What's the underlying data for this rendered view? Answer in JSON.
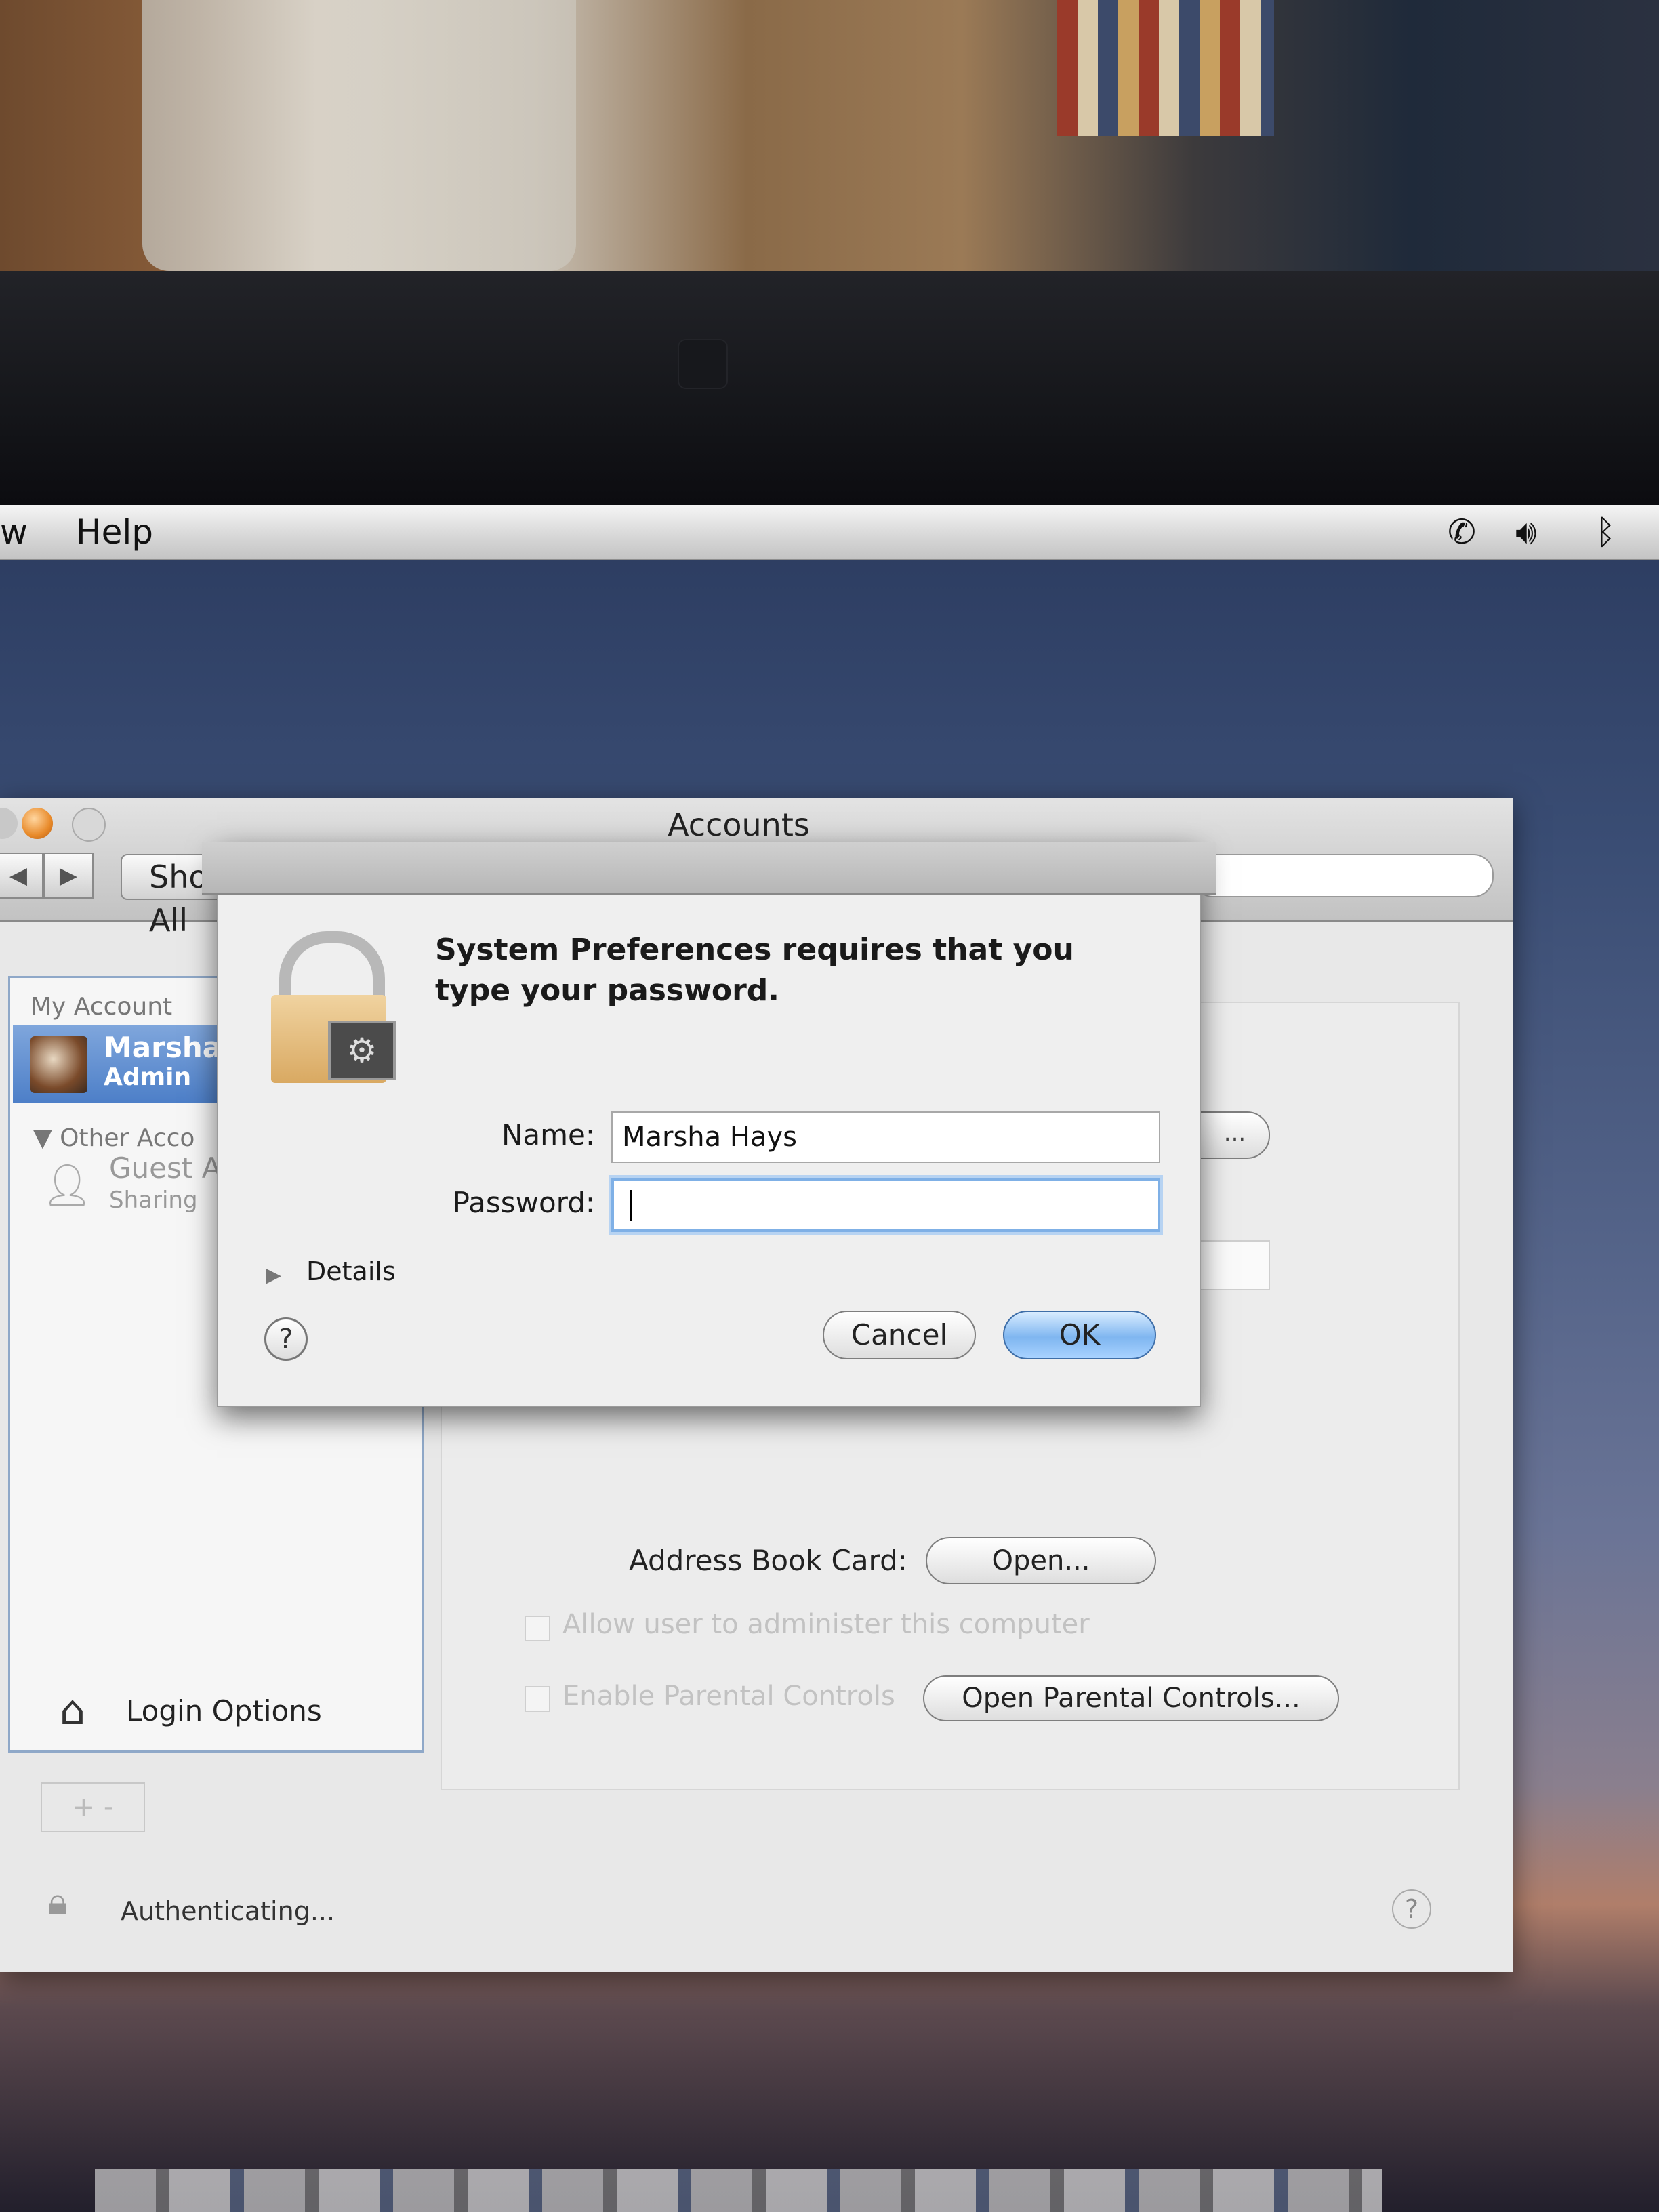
{
  "menubar": {
    "items": [
      "w",
      "Help"
    ],
    "status_icons": [
      "phone-icon",
      "volume-icon",
      "bluetooth-icon"
    ]
  },
  "window": {
    "title": "Accounts",
    "toolbar": {
      "show_all": "Show All"
    },
    "sidebar": {
      "my_account_header": "My Account",
      "user_name": "Marsha",
      "user_role": "Admin",
      "other_accounts_header": "Other Acco",
      "guest_name": "Guest A",
      "guest_sub": "Sharing",
      "login_options": "Login Options",
      "add_remove": "+ -"
    },
    "panel": {
      "address_book_label": "Address Book Card:",
      "open_button": "Open...",
      "allow_admin": "Allow user to administer this computer",
      "enable_parental": "Enable Parental Controls",
      "open_parental_button": "Open Parental Controls...",
      "edit_button": "..."
    },
    "status": {
      "authenticating": "Authenticating..."
    }
  },
  "sheet": {
    "prompt": "System Preferences requires that you type your password.",
    "name_label": "Name:",
    "name_value": "Marsha Hays",
    "password_label": "Password:",
    "password_value": "",
    "details": "Details",
    "help": "?",
    "cancel": "Cancel",
    "ok": "OK"
  },
  "colors": {
    "selection": "#4d7fc8",
    "default_button": "#7fb6f0",
    "focus_ring": "#7fb0e6"
  }
}
